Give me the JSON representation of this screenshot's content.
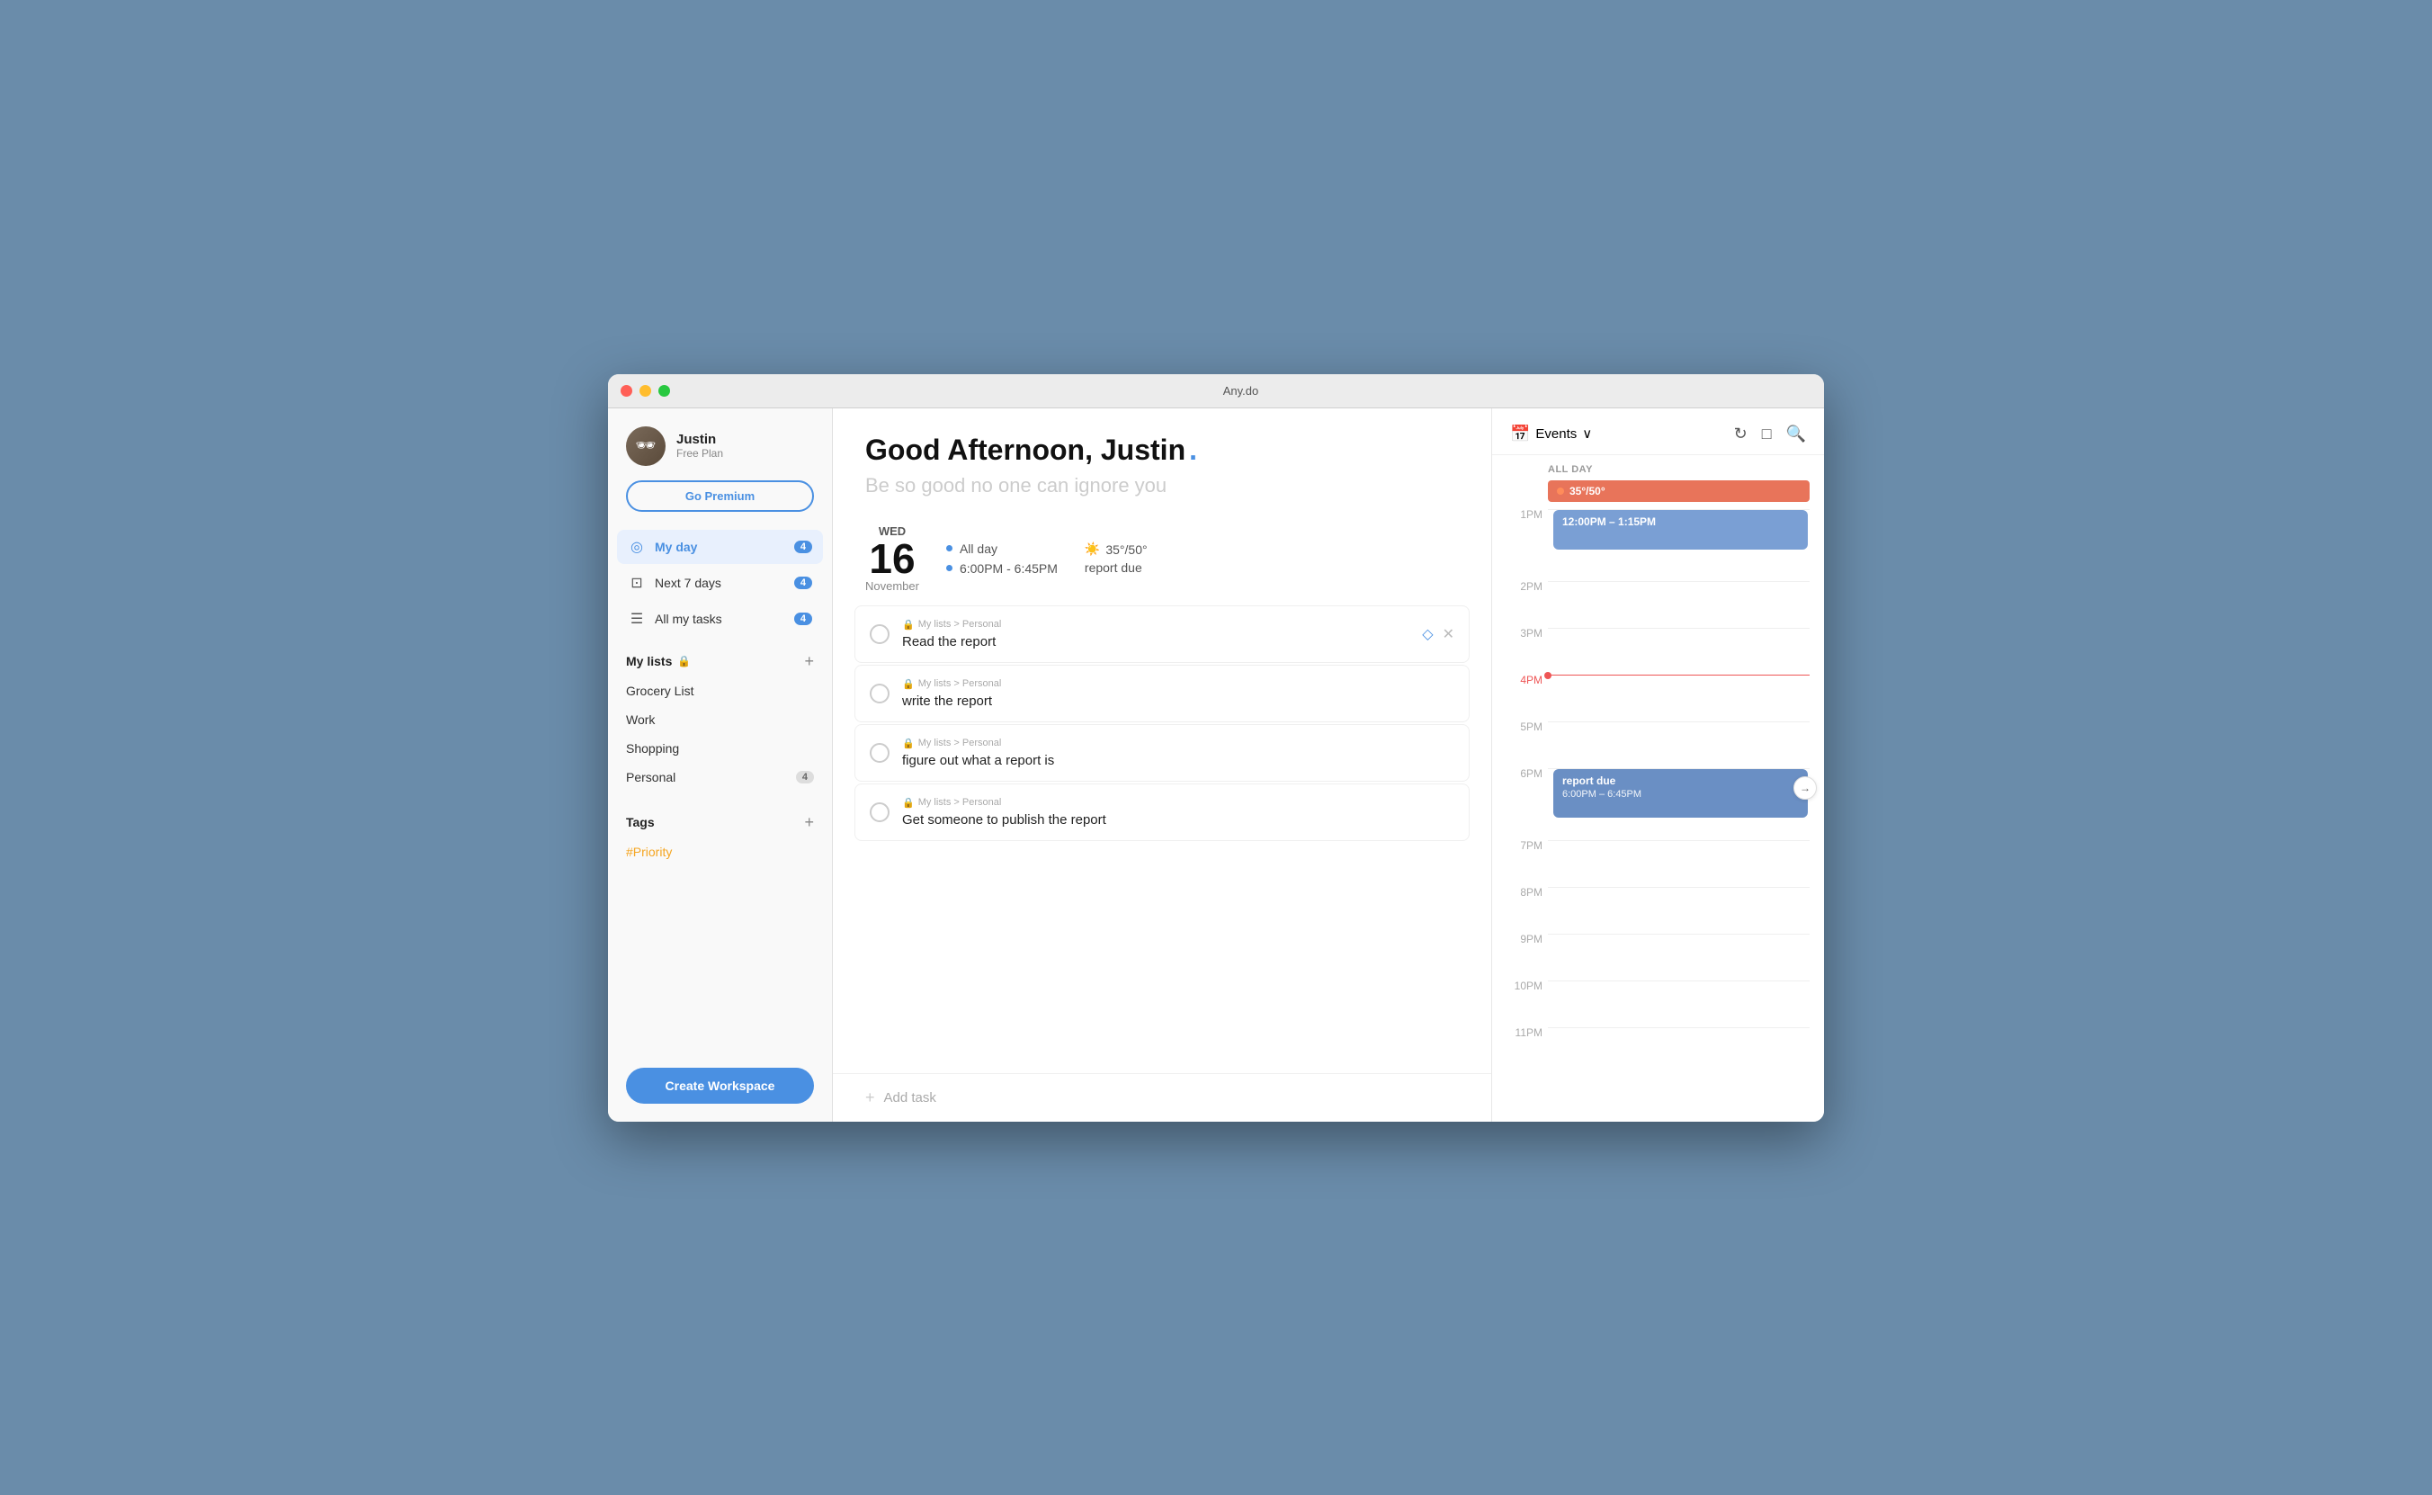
{
  "window": {
    "title": "Any.do"
  },
  "sidebar": {
    "user": {
      "name": "Justin",
      "plan": "Free Plan"
    },
    "go_premium_label": "Go Premium",
    "nav": [
      {
        "id": "my-day",
        "label": "My day",
        "icon": "◎",
        "badge": "4",
        "active": true
      },
      {
        "id": "next-7",
        "label": "Next 7 days",
        "icon": "⊡",
        "badge": "4",
        "active": false
      },
      {
        "id": "all-tasks",
        "label": "All my tasks",
        "icon": "☰",
        "badge": "4",
        "active": false
      }
    ],
    "lists_section": {
      "title": "My lists",
      "add_label": "+",
      "items": [
        {
          "id": "grocery",
          "label": "Grocery List",
          "badge": null
        },
        {
          "id": "work",
          "label": "Work",
          "badge": null
        },
        {
          "id": "shopping",
          "label": "Shopping",
          "badge": null
        },
        {
          "id": "personal",
          "label": "Personal",
          "badge": "4"
        }
      ]
    },
    "tags_section": {
      "title": "Tags",
      "add_label": "+",
      "items": [
        {
          "id": "priority",
          "label": "#Priority"
        }
      ]
    },
    "create_workspace_label": "Create Workspace"
  },
  "main": {
    "greeting": "Good Afternoon, Justin",
    "greeting_dot": ".",
    "subtitle": "Be so good no one can ignore you",
    "date": {
      "day_label": "WED",
      "number": "16",
      "month": "November"
    },
    "date_info": [
      {
        "label": "All day"
      },
      {
        "label": "6:00PM - 6:45PM"
      }
    ],
    "weather": {
      "temp": "35°/50°",
      "event": "report due"
    },
    "tasks": [
      {
        "id": "task-1",
        "path": "My lists > Personal",
        "title": "Read the report",
        "pinned": true
      },
      {
        "id": "task-2",
        "path": "My lists > Personal",
        "title": "write the report",
        "pinned": false
      },
      {
        "id": "task-3",
        "path": "My lists > Personal",
        "title": "figure out what a report is",
        "pinned": false
      },
      {
        "id": "task-4",
        "path": "My lists > Personal",
        "title": "Get someone to publish the report",
        "pinned": false
      }
    ],
    "add_task_placeholder": "Add task"
  },
  "calendar": {
    "header": {
      "events_label": "Events",
      "chevron": "∨"
    },
    "all_day_label": "ALL DAY",
    "all_day_event": "35°/50°",
    "time_slots": [
      {
        "time": "1PM",
        "events": [
          {
            "title": "12:00PM – 1:15PM",
            "color": "blue",
            "top": "0",
            "height": "46"
          }
        ]
      },
      {
        "time": "2PM",
        "events": []
      },
      {
        "time": "3PM",
        "events": []
      },
      {
        "time": "4PM",
        "events": [],
        "now": true
      },
      {
        "time": "5PM",
        "events": []
      },
      {
        "time": "6PM",
        "events": [
          {
            "title": "report due",
            "subtitle": "6:00PM – 6:45PM",
            "color": "blue2",
            "top": "2",
            "height": "48"
          }
        ]
      },
      {
        "time": "7PM",
        "events": []
      },
      {
        "time": "8PM",
        "events": []
      },
      {
        "time": "9PM",
        "events": []
      },
      {
        "time": "10PM",
        "events": []
      },
      {
        "time": "11PM",
        "events": []
      }
    ]
  }
}
